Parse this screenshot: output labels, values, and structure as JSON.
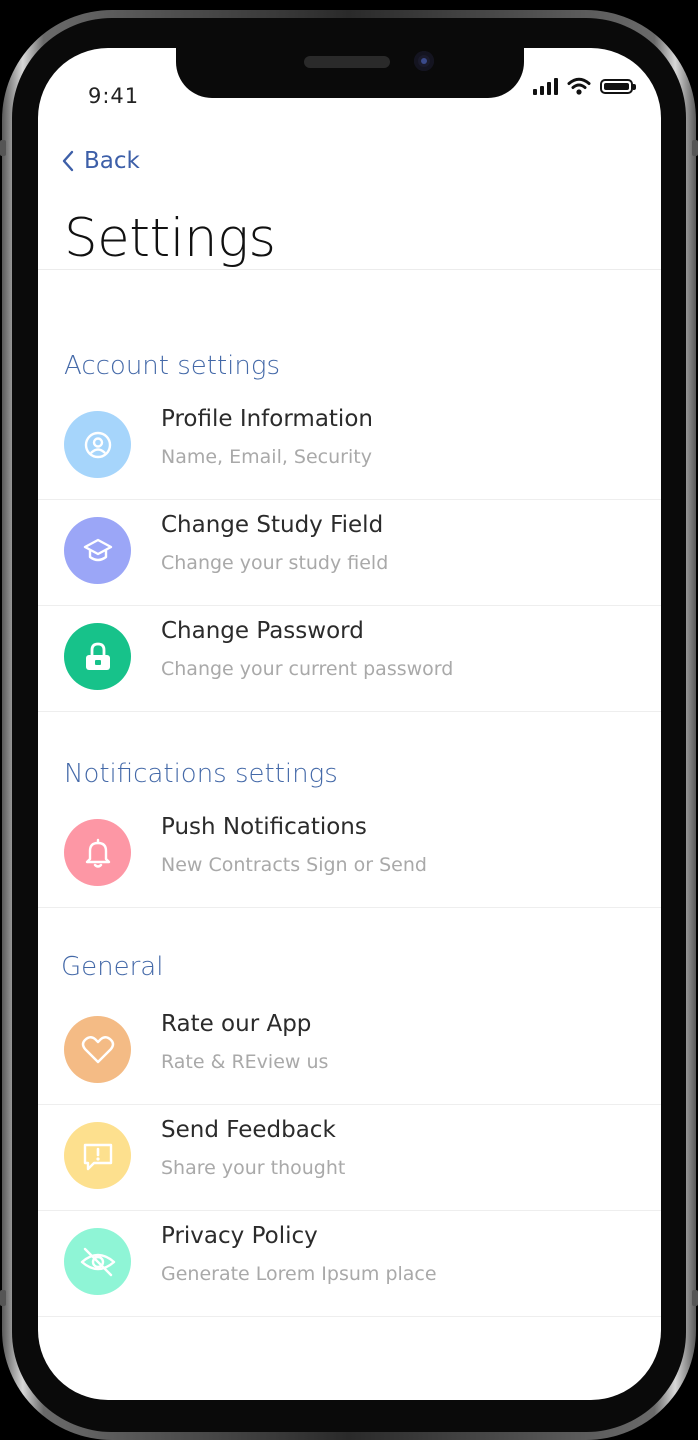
{
  "status_bar": {
    "time": "9:41"
  },
  "nav": {
    "back_label": "Back"
  },
  "page": {
    "title": "Settings"
  },
  "sections": [
    {
      "title": "Account settings",
      "items": [
        {
          "title": "Profile Information",
          "subtitle": "Name, Email, Security",
          "icon": "profile-icon",
          "color": "#a6d5fb"
        },
        {
          "title": "Change Study Field",
          "subtitle": "Change your study field",
          "icon": "graduation-cap-icon",
          "color": "#9ba6f7"
        },
        {
          "title": "Change Password",
          "subtitle": "Change your current password",
          "icon": "lock-icon",
          "color": "#17c28a"
        }
      ]
    },
    {
      "title": "Notifications settings",
      "items": [
        {
          "title": "Push Notifications",
          "subtitle": "New Contracts Sign or Send",
          "icon": "bell-icon",
          "color": "#fd97a5"
        }
      ]
    },
    {
      "title": "General",
      "items": [
        {
          "title": "Rate our App",
          "subtitle": "Rate & REview us",
          "icon": "heart-icon",
          "color": "#f4bb85"
        },
        {
          "title": "Send Feedback",
          "subtitle": "Share your thought",
          "icon": "feedback-icon",
          "color": "#fde08e"
        },
        {
          "title": "Privacy Policy",
          "subtitle": "Generate Lorem Ipsum place",
          "icon": "eye-off-icon",
          "color": "#8ff5d6"
        }
      ]
    }
  ]
}
